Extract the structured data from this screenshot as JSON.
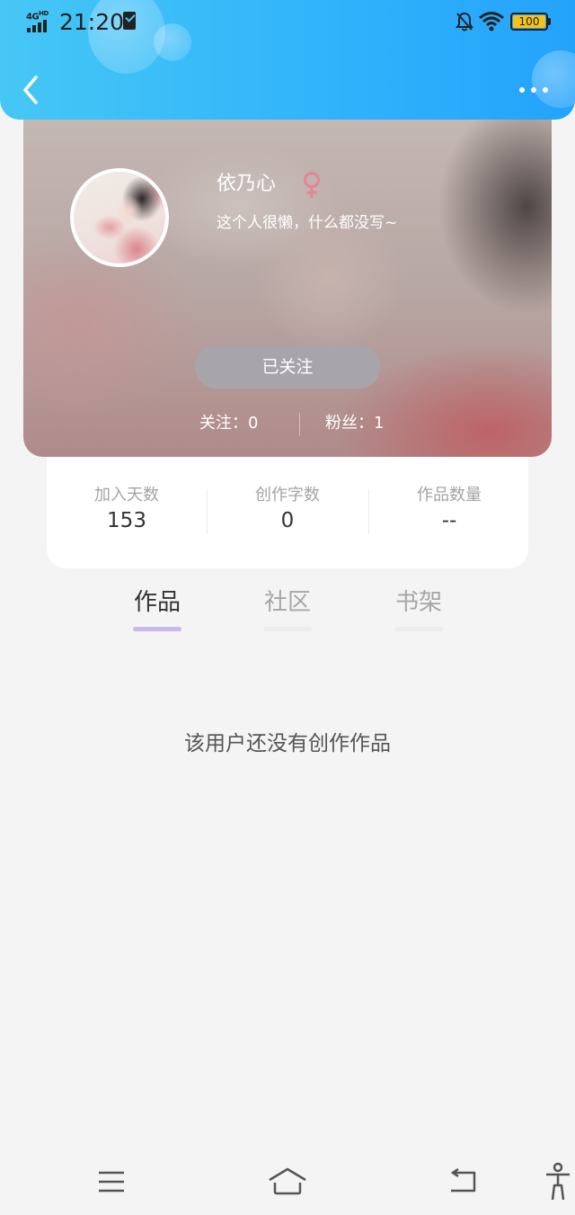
{
  "status_bar": {
    "network_label": "4G",
    "network_hd": "HD",
    "time": "21:20",
    "battery_level": "100"
  },
  "header": {
    "back_icon": "chevron-left-icon",
    "more_icon": "more-dots-icon"
  },
  "profile": {
    "name": "依乃心",
    "gender_icon": "female-icon",
    "bio": "这个人很懒，什么都没写~",
    "follow_button_label": "已关注",
    "following_label": "关注：0",
    "fans_label": "粉丝：1"
  },
  "stats": [
    {
      "label": "加入天数",
      "value": "153"
    },
    {
      "label": "创作字数",
      "value": "0"
    },
    {
      "label": "作品数量",
      "value": "--"
    }
  ],
  "tabs": [
    {
      "label": "作品",
      "active": true
    },
    {
      "label": "社区",
      "active": false
    },
    {
      "label": "书架",
      "active": false
    }
  ],
  "empty_message": "该用户还没有创作作品",
  "nav_bar": {
    "menu_icon": "menu-icon",
    "home_icon": "home-icon",
    "back_icon": "back-icon",
    "accessibility_icon": "accessibility-icon"
  },
  "colors": {
    "header_start": "#46c7f5",
    "header_end": "#24a3fb",
    "tab_active_underline": "#cdb7e6",
    "gender_icon": "#e58497",
    "battery": "#f6c21a"
  }
}
